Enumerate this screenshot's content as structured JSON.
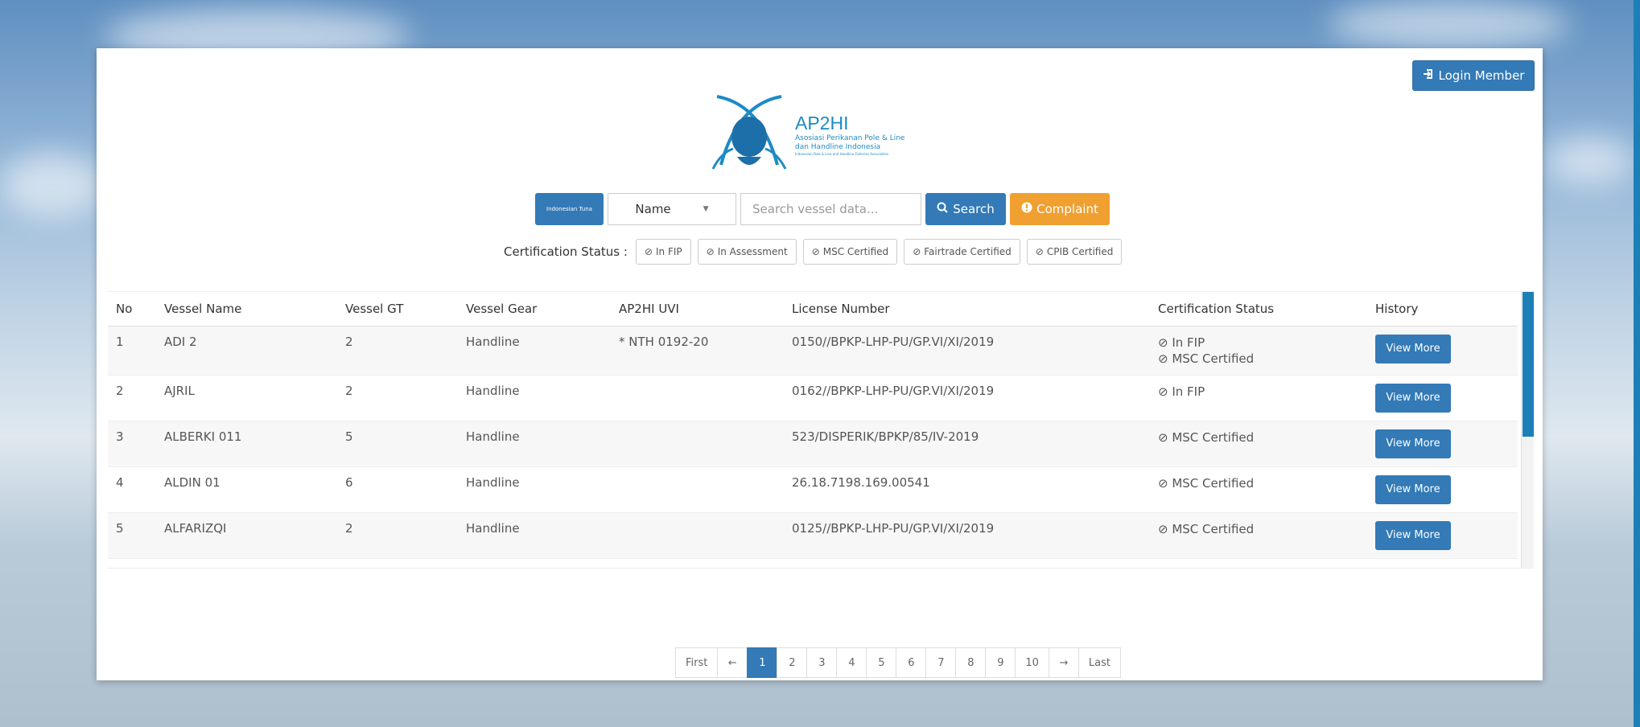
{
  "header": {
    "login_label": "Login Member",
    "logo": {
      "title": "AP2HI",
      "subtitle1": "Asosiasi Perikanan Pole & Line",
      "subtitle2": "dan Handline Indonesia",
      "tagline": "Indonesian Pole & Line and Handline Fisheries Association"
    }
  },
  "search": {
    "flag_label": "Indonesian Tuna",
    "field_select": "Name",
    "placeholder": "Search vessel data...",
    "search_label": "Search",
    "complaint_label": "Complaint"
  },
  "cert_filter": {
    "label": "Certification Status :",
    "options": [
      "In FIP",
      "In Assessment",
      "MSC Certified",
      "Fairtrade Certified",
      "CPIB Certified"
    ]
  },
  "table": {
    "columns": [
      "No",
      "Vessel Name",
      "Vessel GT",
      "Vessel Gear",
      "AP2HI UVI",
      "License Number",
      "Certification Status",
      "History"
    ],
    "rows": [
      {
        "no": "1",
        "name": "ADI 2",
        "gt": "2",
        "gear": "Handline",
        "uvi": "* NTH 0192-20",
        "license": "0150//BPKP-LHP-PU/GP.VI/XI/2019",
        "certs": [
          "In FIP",
          "MSC Certified"
        ],
        "history": "View More"
      },
      {
        "no": "2",
        "name": "AJRIL",
        "gt": "2",
        "gear": "Handline",
        "uvi": "",
        "license": "0162//BPKP-LHP-PU/GP.VI/XI/2019",
        "certs": [
          "In FIP"
        ],
        "history": "View More"
      },
      {
        "no": "3",
        "name": "ALBERKI 011",
        "gt": "5",
        "gear": "Handline",
        "uvi": "",
        "license": "523/DISPERIK/BPKP/85/IV-2019",
        "certs": [
          "MSC Certified"
        ],
        "history": "View More"
      },
      {
        "no": "4",
        "name": "ALDIN 01",
        "gt": "6",
        "gear": "Handline",
        "uvi": "",
        "license": "26.18.7198.169.00541",
        "certs": [
          "MSC Certified"
        ],
        "history": "View More"
      },
      {
        "no": "5",
        "name": "ALFARIZQI",
        "gt": "2",
        "gear": "Handline",
        "uvi": "",
        "license": "0125//BPKP-LHP-PU/GP.VI/XI/2019",
        "certs": [
          "MSC Certified"
        ],
        "history": "View More"
      }
    ]
  },
  "pagination": {
    "first": "First",
    "prev": "←",
    "pages": [
      "1",
      "2",
      "3",
      "4",
      "5",
      "6",
      "7",
      "8",
      "9",
      "10"
    ],
    "active": "1",
    "next": "→",
    "last": "Last"
  },
  "colors": {
    "primary": "#337ab7",
    "warning": "#f0a030",
    "logo": "#1c8bc6"
  }
}
